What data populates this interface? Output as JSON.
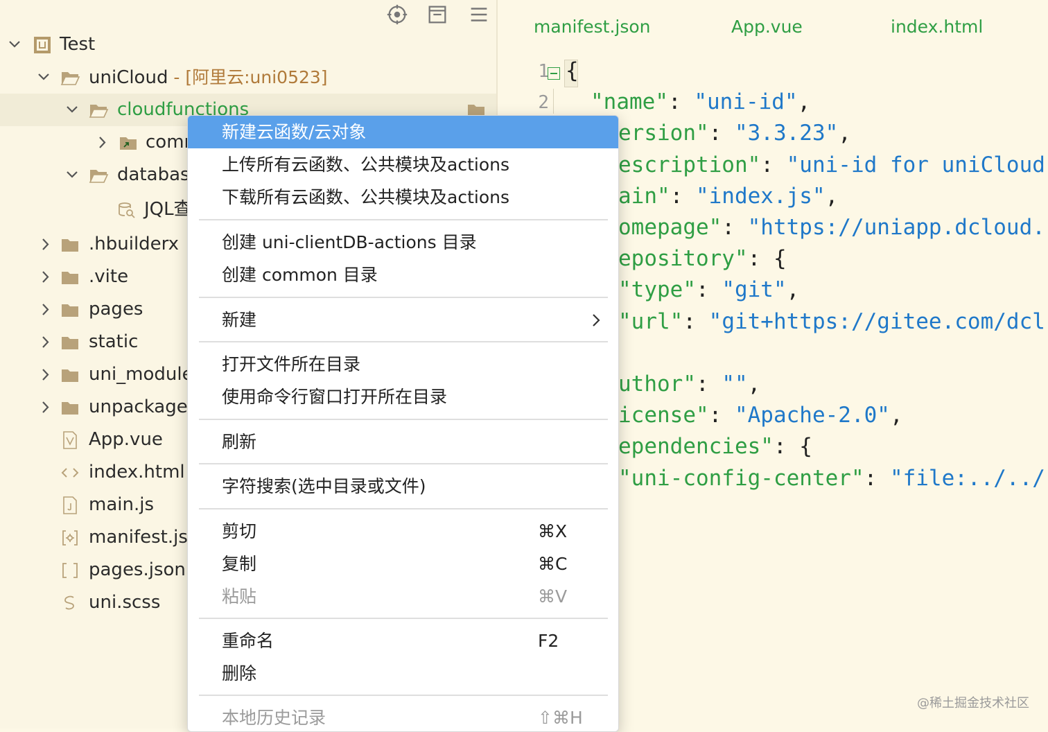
{
  "toolbar": {
    "icons": [
      "locate-icon",
      "collapse-icon",
      "menu-icon"
    ]
  },
  "tree": [
    {
      "label": "Test",
      "icon": "project-icon",
      "chevron": "down"
    },
    {
      "label": "uniCloud",
      "suffix": " - [阿里云:uni0523]",
      "icon": "folder-open-icon",
      "chevron": "down"
    },
    {
      "label": "cloudfunctions",
      "icon": "folder-open-icon",
      "chevron": "down"
    },
    {
      "label": "comr",
      "icon": "folder-link-icon",
      "chevron": "right"
    },
    {
      "label": "database",
      "icon": "folder-open-icon",
      "chevron": "down"
    },
    {
      "label": "JQL查",
      "icon": "jql-icon"
    },
    {
      "label": ".hbuilderx",
      "icon": "folder-icon",
      "chevron": "right"
    },
    {
      "label": ".vite",
      "icon": "folder-icon",
      "chevron": "right"
    },
    {
      "label": "pages",
      "icon": "folder-icon",
      "chevron": "right"
    },
    {
      "label": "static",
      "icon": "folder-icon",
      "chevron": "right"
    },
    {
      "label": "uni_modules",
      "icon": "folder-icon",
      "chevron": "right"
    },
    {
      "label": "unpackage",
      "icon": "folder-icon",
      "chevron": "right"
    },
    {
      "label": "App.vue",
      "icon": "vue-file-icon"
    },
    {
      "label": "index.html",
      "icon": "html-file-icon"
    },
    {
      "label": "main.js",
      "icon": "js-file-icon"
    },
    {
      "label": "manifest.json",
      "icon": "manifest-file-icon"
    },
    {
      "label": "pages.json",
      "icon": "json-file-icon"
    },
    {
      "label": "uni.scss",
      "icon": "scss-file-icon"
    }
  ],
  "tabs": [
    "manifest.json",
    "App.vue",
    "index.html"
  ],
  "editor": {
    "line_numbers": [
      "1",
      "2"
    ],
    "lines": [
      [
        {
          "t": "p",
          "v": "{"
        }
      ],
      [
        {
          "t": "k",
          "v": "\"name\""
        },
        {
          "t": "p",
          "v": ": "
        },
        {
          "t": "s",
          "v": "\"uni-id\""
        },
        {
          "t": "p",
          "v": ","
        }
      ],
      [
        {
          "t": "k",
          "v": "ersion\""
        },
        {
          "t": "p",
          "v": ": "
        },
        {
          "t": "s",
          "v": "\"3.3.23\""
        },
        {
          "t": "p",
          "v": ","
        }
      ],
      [
        {
          "t": "k",
          "v": "escription\""
        },
        {
          "t": "p",
          "v": ": "
        },
        {
          "t": "s",
          "v": "\"uni-id for uniCloud"
        }
      ],
      [
        {
          "t": "k",
          "v": "ain\""
        },
        {
          "t": "p",
          "v": ": "
        },
        {
          "t": "s",
          "v": "\"index.js\""
        },
        {
          "t": "p",
          "v": ","
        }
      ],
      [
        {
          "t": "k",
          "v": "omepage\""
        },
        {
          "t": "p",
          "v": ": "
        },
        {
          "t": "s",
          "v": "\"https://uniapp.dcloud."
        }
      ],
      [
        {
          "t": "k",
          "v": "epository\""
        },
        {
          "t": "p",
          "v": ": {"
        }
      ],
      [
        {
          "t": "k",
          "v": "\"type\""
        },
        {
          "t": "p",
          "v": ": "
        },
        {
          "t": "s",
          "v": "\"git\""
        },
        {
          "t": "p",
          "v": ","
        }
      ],
      [
        {
          "t": "k",
          "v": "\"url\""
        },
        {
          "t": "p",
          "v": ": "
        },
        {
          "t": "s",
          "v": "\"git+https://gitee.com/dcl"
        }
      ],
      [],
      [
        {
          "t": "k",
          "v": "uthor\""
        },
        {
          "t": "p",
          "v": ": "
        },
        {
          "t": "s",
          "v": "\"\""
        },
        {
          "t": "p",
          "v": ","
        }
      ],
      [
        {
          "t": "k",
          "v": "icense\""
        },
        {
          "t": "p",
          "v": ": "
        },
        {
          "t": "s",
          "v": "\"Apache-2.0\""
        },
        {
          "t": "p",
          "v": ","
        }
      ],
      [
        {
          "t": "k",
          "v": "ependencies\""
        },
        {
          "t": "p",
          "v": ": {"
        }
      ],
      [
        {
          "t": "k",
          "v": "\"uni-config-center\""
        },
        {
          "t": "p",
          "v": ": "
        },
        {
          "t": "s",
          "v": "\"file:../../"
        }
      ]
    ]
  },
  "context_menu": [
    {
      "type": "item",
      "label": "新建云函数/云对象",
      "active": true
    },
    {
      "type": "item",
      "label": "上传所有云函数、公共模块及actions"
    },
    {
      "type": "item",
      "label": "下载所有云函数、公共模块及actions"
    },
    {
      "type": "sep"
    },
    {
      "type": "item",
      "label": "创建 uni-clientDB-actions 目录"
    },
    {
      "type": "item",
      "label": "创建 common 目录"
    },
    {
      "type": "sep"
    },
    {
      "type": "item",
      "label": "新建",
      "submenu": true
    },
    {
      "type": "sep"
    },
    {
      "type": "item",
      "label": "打开文件所在目录"
    },
    {
      "type": "item",
      "label": "使用命令行窗口打开所在目录"
    },
    {
      "type": "sep"
    },
    {
      "type": "item",
      "label": "刷新"
    },
    {
      "type": "sep"
    },
    {
      "type": "item",
      "label": "字符搜索(选中目录或文件)"
    },
    {
      "type": "sep"
    },
    {
      "type": "item",
      "label": "剪切",
      "shortcut": "⌘X"
    },
    {
      "type": "item",
      "label": "复制",
      "shortcut": "⌘C"
    },
    {
      "type": "item",
      "label": "粘贴",
      "shortcut": "⌘V",
      "disabled": true
    },
    {
      "type": "sep"
    },
    {
      "type": "item",
      "label": "重命名",
      "shortcut": "F2"
    },
    {
      "type": "item",
      "label": "删除"
    },
    {
      "type": "sep"
    },
    {
      "type": "item",
      "label": "本地历史记录",
      "shortcut": "⇧⌘H",
      "disabled": true
    }
  ],
  "watermark": "@稀土掘金技术社区",
  "colors": {
    "background": "#fdf8e6",
    "accent_green": "#2f9e44",
    "string_blue": "#1f78c9",
    "menu_highlight": "#5aa0ea"
  }
}
